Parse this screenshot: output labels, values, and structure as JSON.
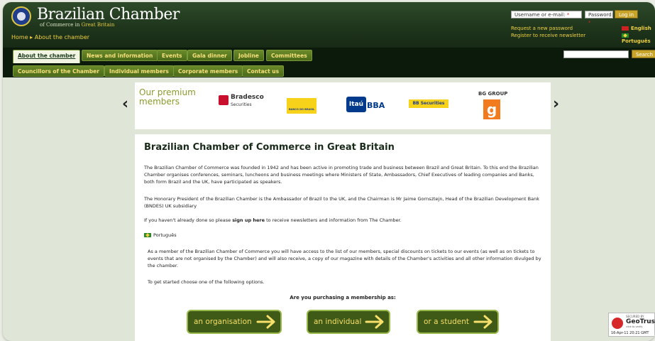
{
  "header": {
    "logo_title": "Brazilian Chamber",
    "logo_sub_a": "of Commerce in ",
    "logo_sub_b": "Great Britain",
    "breadcrumb_home": "Home",
    "breadcrumb_sep": " ▸ ",
    "breadcrumb_current": "About the chamber",
    "username_placeholder": "Username or e-mail: ",
    "password_placeholder": "Password: ",
    "required_mark": "*",
    "login_button": "Log in",
    "request_password": "Request a new password",
    "register_newsletter": "Register to receive newsletter",
    "lang_english": "English",
    "lang_portugues": "Português",
    "search_button": "Search"
  },
  "nav_primary": [
    {
      "label": "About the chamber",
      "active": true
    },
    {
      "label": "News and information"
    },
    {
      "label": "Events"
    },
    {
      "label": "Gala dinner"
    },
    {
      "label": "Jobline"
    },
    {
      "label": "Committees"
    }
  ],
  "nav_secondary": [
    {
      "label": "Councillors of the Chamber"
    },
    {
      "label": "Individual members"
    },
    {
      "label": "Corporate members"
    },
    {
      "label": "Contact us"
    }
  ],
  "premium": {
    "title_line1": "Our premium",
    "title_line2": "members",
    "prev_arrow": "‹",
    "next_arrow": "›",
    "bradesco_name": "Bradesco",
    "bradesco_sub": "Securities",
    "bb_text": "BANCO DO BRASIL",
    "itau_box": "Itaú",
    "itau_bba": "BBA",
    "bbsec_text": "BB Securities",
    "bg_group": "BG GROUP",
    "bg_letter": "g"
  },
  "content": {
    "heading": "Brazilian Chamber of Commerce in Great Britain",
    "para1": "The Brazilian Chamber of Commerce was founded in 1942 and has been active in promoting trade and business between Brazil and Great Britain. To this end the Brazilian Chamber organises conferences, seminars, luncheons and business meetings where Ministers of State, Ambassadors, Chief Executives of leading companies and Banks, both form Brazil and the UK, have participated as speakers.",
    "para2": "The Honorary President of the Brazilian Chamber is the Ambassador of Brazil to the UK, and the Chairman is Mr Jaime Gornsztejn, Head of the Brazilian Development Bank (BNDES) UK subsidiary",
    "para3_a": "If you haven't already done so please ",
    "para3_link": "sign up here",
    "para3_b": " to receive newsletters and information from The Chamber.",
    "portugues_link": "Português",
    "para4": "As a member of the Brazilian Chamber of Commerce you will have access to the list of  our members, special discounts on tickets to our events (as well as on tickets to events that are not organised by the Chamber) and will also receive, a copy of our magazine with details of the Chamber's activities and all other information divulged by the chamber.",
    "para5": "To get started choose one of the following options.",
    "question": "Are you purchasing a membership as:",
    "btn_org": "an organisation",
    "btn_ind": "an individual",
    "btn_stu": "or a student"
  },
  "geotrust": {
    "top": "SECURED BY",
    "name": "GeoTrust",
    "click": "click to verify",
    "date": "16-Apr-11 20:21 GMT"
  },
  "colors": {
    "header_bg": "#1e341b",
    "accent_yellow": "#f0d040",
    "tab_green": "#4a6a1a",
    "button_bg": "#3e5a16"
  }
}
